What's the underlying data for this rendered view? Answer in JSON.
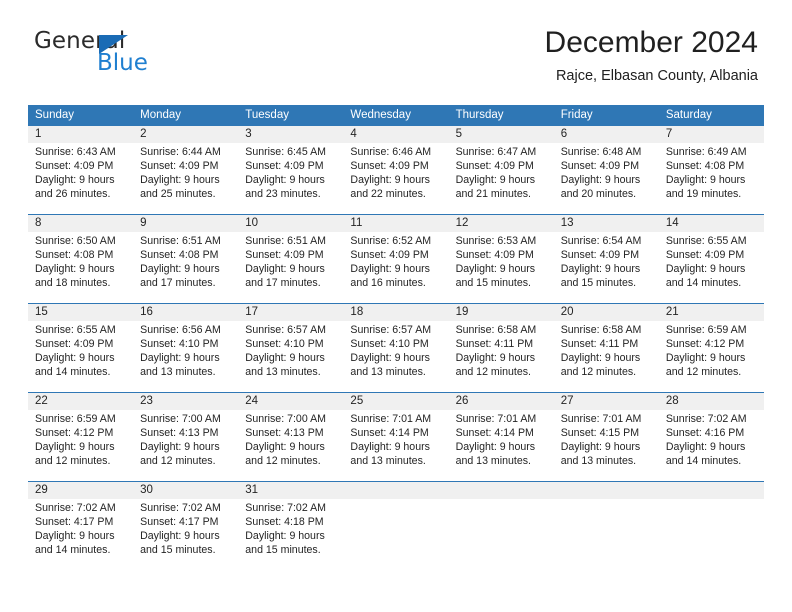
{
  "logo": {
    "word_top": "General",
    "word_bottom": "Blue",
    "triangle_icon": "triangle-icon",
    "brand_blue": "#1f7fd0",
    "brand_dark": "#2b2b2b"
  },
  "header": {
    "month_title": "December 2024",
    "location": "Rajce, Elbasan County, Albania"
  },
  "calendar": {
    "header_bg": "#2f77b5",
    "daynum_band_bg": "#f0f0f0",
    "weekdays": [
      "Sunday",
      "Monday",
      "Tuesday",
      "Wednesday",
      "Thursday",
      "Friday",
      "Saturday"
    ],
    "weeks": [
      [
        {
          "day": "1",
          "sunrise": "Sunrise: 6:43 AM",
          "sunset": "Sunset: 4:09 PM",
          "daylight_1": "Daylight: 9 hours",
          "daylight_2": "and 26 minutes."
        },
        {
          "day": "2",
          "sunrise": "Sunrise: 6:44 AM",
          "sunset": "Sunset: 4:09 PM",
          "daylight_1": "Daylight: 9 hours",
          "daylight_2": "and 25 minutes."
        },
        {
          "day": "3",
          "sunrise": "Sunrise: 6:45 AM",
          "sunset": "Sunset: 4:09 PM",
          "daylight_1": "Daylight: 9 hours",
          "daylight_2": "and 23 minutes."
        },
        {
          "day": "4",
          "sunrise": "Sunrise: 6:46 AM",
          "sunset": "Sunset: 4:09 PM",
          "daylight_1": "Daylight: 9 hours",
          "daylight_2": "and 22 minutes."
        },
        {
          "day": "5",
          "sunrise": "Sunrise: 6:47 AM",
          "sunset": "Sunset: 4:09 PM",
          "daylight_1": "Daylight: 9 hours",
          "daylight_2": "and 21 minutes."
        },
        {
          "day": "6",
          "sunrise": "Sunrise: 6:48 AM",
          "sunset": "Sunset: 4:09 PM",
          "daylight_1": "Daylight: 9 hours",
          "daylight_2": "and 20 minutes."
        },
        {
          "day": "7",
          "sunrise": "Sunrise: 6:49 AM",
          "sunset": "Sunset: 4:08 PM",
          "daylight_1": "Daylight: 9 hours",
          "daylight_2": "and 19 minutes."
        }
      ],
      [
        {
          "day": "8",
          "sunrise": "Sunrise: 6:50 AM",
          "sunset": "Sunset: 4:08 PM",
          "daylight_1": "Daylight: 9 hours",
          "daylight_2": "and 18 minutes."
        },
        {
          "day": "9",
          "sunrise": "Sunrise: 6:51 AM",
          "sunset": "Sunset: 4:08 PM",
          "daylight_1": "Daylight: 9 hours",
          "daylight_2": "and 17 minutes."
        },
        {
          "day": "10",
          "sunrise": "Sunrise: 6:51 AM",
          "sunset": "Sunset: 4:09 PM",
          "daylight_1": "Daylight: 9 hours",
          "daylight_2": "and 17 minutes."
        },
        {
          "day": "11",
          "sunrise": "Sunrise: 6:52 AM",
          "sunset": "Sunset: 4:09 PM",
          "daylight_1": "Daylight: 9 hours",
          "daylight_2": "and 16 minutes."
        },
        {
          "day": "12",
          "sunrise": "Sunrise: 6:53 AM",
          "sunset": "Sunset: 4:09 PM",
          "daylight_1": "Daylight: 9 hours",
          "daylight_2": "and 15 minutes."
        },
        {
          "day": "13",
          "sunrise": "Sunrise: 6:54 AM",
          "sunset": "Sunset: 4:09 PM",
          "daylight_1": "Daylight: 9 hours",
          "daylight_2": "and 15 minutes."
        },
        {
          "day": "14",
          "sunrise": "Sunrise: 6:55 AM",
          "sunset": "Sunset: 4:09 PM",
          "daylight_1": "Daylight: 9 hours",
          "daylight_2": "and 14 minutes."
        }
      ],
      [
        {
          "day": "15",
          "sunrise": "Sunrise: 6:55 AM",
          "sunset": "Sunset: 4:09 PM",
          "daylight_1": "Daylight: 9 hours",
          "daylight_2": "and 14 minutes."
        },
        {
          "day": "16",
          "sunrise": "Sunrise: 6:56 AM",
          "sunset": "Sunset: 4:10 PM",
          "daylight_1": "Daylight: 9 hours",
          "daylight_2": "and 13 minutes."
        },
        {
          "day": "17",
          "sunrise": "Sunrise: 6:57 AM",
          "sunset": "Sunset: 4:10 PM",
          "daylight_1": "Daylight: 9 hours",
          "daylight_2": "and 13 minutes."
        },
        {
          "day": "18",
          "sunrise": "Sunrise: 6:57 AM",
          "sunset": "Sunset: 4:10 PM",
          "daylight_1": "Daylight: 9 hours",
          "daylight_2": "and 13 minutes."
        },
        {
          "day": "19",
          "sunrise": "Sunrise: 6:58 AM",
          "sunset": "Sunset: 4:11 PM",
          "daylight_1": "Daylight: 9 hours",
          "daylight_2": "and 12 minutes."
        },
        {
          "day": "20",
          "sunrise": "Sunrise: 6:58 AM",
          "sunset": "Sunset: 4:11 PM",
          "daylight_1": "Daylight: 9 hours",
          "daylight_2": "and 12 minutes."
        },
        {
          "day": "21",
          "sunrise": "Sunrise: 6:59 AM",
          "sunset": "Sunset: 4:12 PM",
          "daylight_1": "Daylight: 9 hours",
          "daylight_2": "and 12 minutes."
        }
      ],
      [
        {
          "day": "22",
          "sunrise": "Sunrise: 6:59 AM",
          "sunset": "Sunset: 4:12 PM",
          "daylight_1": "Daylight: 9 hours",
          "daylight_2": "and 12 minutes."
        },
        {
          "day": "23",
          "sunrise": "Sunrise: 7:00 AM",
          "sunset": "Sunset: 4:13 PM",
          "daylight_1": "Daylight: 9 hours",
          "daylight_2": "and 12 minutes."
        },
        {
          "day": "24",
          "sunrise": "Sunrise: 7:00 AM",
          "sunset": "Sunset: 4:13 PM",
          "daylight_1": "Daylight: 9 hours",
          "daylight_2": "and 12 minutes."
        },
        {
          "day": "25",
          "sunrise": "Sunrise: 7:01 AM",
          "sunset": "Sunset: 4:14 PM",
          "daylight_1": "Daylight: 9 hours",
          "daylight_2": "and 13 minutes."
        },
        {
          "day": "26",
          "sunrise": "Sunrise: 7:01 AM",
          "sunset": "Sunset: 4:14 PM",
          "daylight_1": "Daylight: 9 hours",
          "daylight_2": "and 13 minutes."
        },
        {
          "day": "27",
          "sunrise": "Sunrise: 7:01 AM",
          "sunset": "Sunset: 4:15 PM",
          "daylight_1": "Daylight: 9 hours",
          "daylight_2": "and 13 minutes."
        },
        {
          "day": "28",
          "sunrise": "Sunrise: 7:02 AM",
          "sunset": "Sunset: 4:16 PM",
          "daylight_1": "Daylight: 9 hours",
          "daylight_2": "and 14 minutes."
        }
      ],
      [
        {
          "day": "29",
          "sunrise": "Sunrise: 7:02 AM",
          "sunset": "Sunset: 4:17 PM",
          "daylight_1": "Daylight: 9 hours",
          "daylight_2": "and 14 minutes."
        },
        {
          "day": "30",
          "sunrise": "Sunrise: 7:02 AM",
          "sunset": "Sunset: 4:17 PM",
          "daylight_1": "Daylight: 9 hours",
          "daylight_2": "and 15 minutes."
        },
        {
          "day": "31",
          "sunrise": "Sunrise: 7:02 AM",
          "sunset": "Sunset: 4:18 PM",
          "daylight_1": "Daylight: 9 hours",
          "daylight_2": "and 15 minutes."
        },
        {
          "day": "",
          "sunrise": "",
          "sunset": "",
          "daylight_1": "",
          "daylight_2": ""
        },
        {
          "day": "",
          "sunrise": "",
          "sunset": "",
          "daylight_1": "",
          "daylight_2": ""
        },
        {
          "day": "",
          "sunrise": "",
          "sunset": "",
          "daylight_1": "",
          "daylight_2": ""
        },
        {
          "day": "",
          "sunrise": "",
          "sunset": "",
          "daylight_1": "",
          "daylight_2": ""
        }
      ]
    ]
  }
}
